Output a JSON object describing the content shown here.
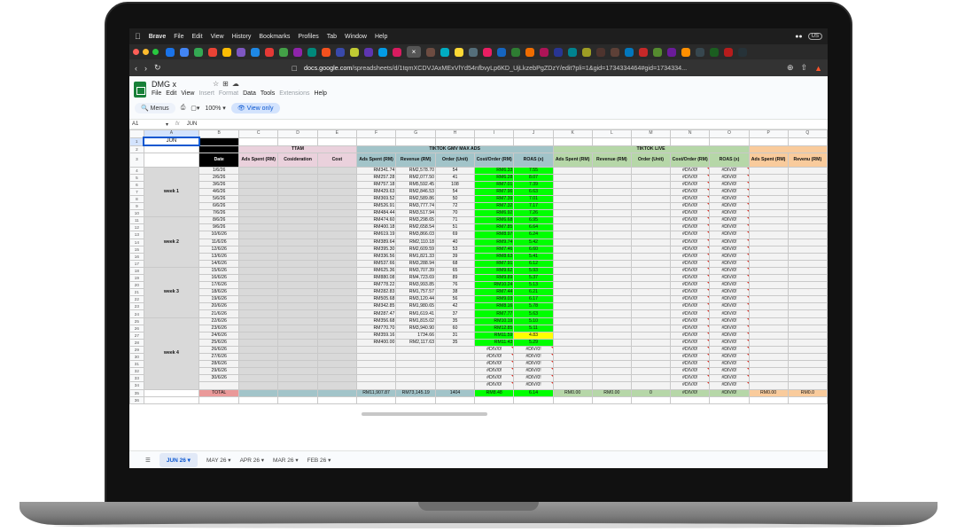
{
  "menubar": {
    "app": "Brave",
    "items": [
      "File",
      "Edit",
      "View",
      "History",
      "Bookmarks",
      "Profiles",
      "Tab",
      "Window",
      "Help"
    ],
    "right_pill": "US"
  },
  "browser": {
    "url_host": "docs.google.com",
    "url_path": "/spreadsheets/d/1tqmXCDVJAxMExVlYd54nfbvyLp6KD_UjLkzebPgZDzY/edit?pli=1&gid=1734334464#gid=1734334..."
  },
  "doc": {
    "title": "DMG x",
    "menu": [
      "File",
      "Edit",
      "View",
      "Insert",
      "Format",
      "Data",
      "Tools",
      "Extensions",
      "Help"
    ],
    "menus_label": "Menus",
    "zoom": "100%",
    "view_only": "View only",
    "cell_ref": "A1",
    "formula": "JUN"
  },
  "columns": [
    "A",
    "B",
    "C",
    "D",
    "E",
    "F",
    "G",
    "H",
    "I",
    "J",
    "K",
    "L",
    "M",
    "N",
    "O",
    "P",
    "Q"
  ],
  "headers": {
    "jun": "JUN",
    "ttam": "TTAM",
    "gmv": "TIKTOK GMV MAX ADS",
    "live": "TIKTOK LIVE",
    "date": "Date",
    "ttam_cols": [
      "Ads Spent (RM)",
      "Cosideration",
      "Cost"
    ],
    "gmv_cols": [
      "Ads Spent (RM)",
      "Revenue (RM)",
      "Order (Unit)",
      "Cost/Order (RM)",
      "ROAS (x)"
    ],
    "live_cols": [
      "Ads Spent (RM)",
      "Revenue (RM)",
      "Order (Unit)",
      "Cost/Order (RM)",
      "ROAS (x)"
    ],
    "next_cols": [
      "Ads Spent (RM)",
      "Revenu (RM)"
    ]
  },
  "weeks": [
    "week 1",
    "week 2",
    "week 3",
    "week 4"
  ],
  "rows": [
    {
      "n": "4",
      "date": "1/6/26",
      "spent": "RM341.74",
      "rev": "RM2,578.70",
      "ord": "54",
      "cpo": "RM6.33",
      "roas": "7.55",
      "live_cpo": "#DIV/0!",
      "live_roas": "#DIV/0!"
    },
    {
      "n": "5",
      "date": "2/6/26",
      "spent": "RM257.28",
      "rev": "RM2,077.50",
      "ord": "41",
      "cpo": "RM6.28",
      "roas": "8.07",
      "live_cpo": "#DIV/0!",
      "live_roas": "#DIV/0!"
    },
    {
      "n": "6",
      "date": "3/6/26",
      "spent": "RM757.18",
      "rev": "RM5,592.45",
      "ord": "108",
      "cpo": "RM7.01",
      "roas": "7.39",
      "live_cpo": "#DIV/0!",
      "live_roas": "#DIV/0!"
    },
    {
      "n": "7",
      "date": "4/6/26",
      "spent": "RM429.63",
      "rev": "RM2,846.53",
      "ord": "54",
      "cpo": "RM7.96",
      "roas": "6.63",
      "live_cpo": "#DIV/0!",
      "live_roas": "#DIV/0!"
    },
    {
      "n": "8",
      "date": "5/6/26",
      "spent": "RM369.52",
      "rev": "RM2,589.86",
      "ord": "50",
      "cpo": "RM7.39",
      "roas": "7.01",
      "live_cpo": "#DIV/0!",
      "live_roas": "#DIV/0!"
    },
    {
      "n": "9",
      "date": "6/6/26",
      "spent": "RM526.91",
      "rev": "RM3,777.74",
      "ord": "72",
      "cpo": "RM7.32",
      "roas": "7.17",
      "live_cpo": "#DIV/0!",
      "live_roas": "#DIV/0!"
    },
    {
      "n": "10",
      "date": "7/6/26",
      "spent": "RM484.44",
      "rev": "RM3,517.94",
      "ord": "70",
      "cpo": "RM6.92",
      "roas": "7.26",
      "live_cpo": "#DIV/0!",
      "live_roas": "#DIV/0!"
    },
    {
      "n": "11",
      "date": "8/6/26",
      "spent": "RM474.60",
      "rev": "RM3,298.65",
      "ord": "71",
      "cpo": "RM6.68",
      "roas": "6.95",
      "live_cpo": "#DIV/0!",
      "live_roas": "#DIV/0!"
    },
    {
      "n": "12",
      "date": "9/6/26",
      "spent": "RM400.18",
      "rev": "RM2,658.54",
      "ord": "51",
      "cpo": "RM7.85",
      "roas": "6.64",
      "live_cpo": "#DIV/0!",
      "live_roas": "#DIV/0!"
    },
    {
      "n": "13",
      "date": "10/6/26",
      "spent": "RM619.19",
      "rev": "RM3,866.03",
      "ord": "69",
      "cpo": "RM8.97",
      "roas": "6.24",
      "live_cpo": "#DIV/0!",
      "live_roas": "#DIV/0!"
    },
    {
      "n": "14",
      "date": "11/6/26",
      "spent": "RM389.64",
      "rev": "RM2,110.18",
      "ord": "40",
      "cpo": "RM9.74",
      "roas": "5.42",
      "live_cpo": "#DIV/0!",
      "live_roas": "#DIV/0!"
    },
    {
      "n": "15",
      "date": "12/6/26",
      "spent": "RM395.30",
      "rev": "RM2,609.59",
      "ord": "53",
      "cpo": "RM7.46",
      "roas": "6.60",
      "live_cpo": "#DIV/0!",
      "live_roas": "#DIV/0!"
    },
    {
      "n": "16",
      "date": "13/6/26",
      "spent": "RM336.56",
      "rev": "RM1,821.33",
      "ord": "39",
      "cpo": "RM8.63",
      "roas": "5.41",
      "live_cpo": "#DIV/0!",
      "live_roas": "#DIV/0!"
    },
    {
      "n": "17",
      "date": "14/6/26",
      "spent": "RM537.66",
      "rev": "RM3,288.94",
      "ord": "68",
      "cpo": "RM7.91",
      "roas": "6.12",
      "live_cpo": "#DIV/0!",
      "live_roas": "#DIV/0!"
    },
    {
      "n": "18",
      "date": "15/6/26",
      "spent": "RM625.36",
      "rev": "RM3,707.39",
      "ord": "65",
      "cpo": "RM9.62",
      "roas": "5.93",
      "live_cpo": "#DIV/0!",
      "live_roas": "#DIV/0!"
    },
    {
      "n": "19",
      "date": "16/6/26",
      "spent": "RM880.08",
      "rev": "RM4,723.69",
      "ord": "89",
      "cpo": "RM9.89",
      "roas": "5.37",
      "live_cpo": "#DIV/0!",
      "live_roas": "#DIV/0!"
    },
    {
      "n": "20",
      "date": "17/6/26",
      "spent": "RM778.22",
      "rev": "RM3,993.85",
      "ord": "76",
      "cpo": "RM10.24",
      "roas": "5.13",
      "live_cpo": "#DIV/0!",
      "live_roas": "#DIV/0!"
    },
    {
      "n": "21",
      "date": "18/6/26",
      "spent": "RM282.83",
      "rev": "RM1,757.57",
      "ord": "38",
      "cpo": "RM7.44",
      "roas": "6.21",
      "live_cpo": "#DIV/0!",
      "live_roas": "#DIV/0!"
    },
    {
      "n": "22",
      "date": "19/6/26",
      "spent": "RM505.68",
      "rev": "RM3,120.44",
      "ord": "56",
      "cpo": "RM9.03",
      "roas": "6.17",
      "live_cpo": "#DIV/0!",
      "live_roas": "#DIV/0!"
    },
    {
      "n": "23",
      "date": "20/6/26",
      "spent": "RM342.85",
      "rev": "RM1,980.65",
      "ord": "42",
      "cpo": "RM8.16",
      "roas": "5.78",
      "live_cpo": "#DIV/0!",
      "live_roas": "#DIV/0!"
    },
    {
      "n": "24",
      "date": "21/6/26",
      "spent": "RM287.47",
      "rev": "RM1,619.41",
      "ord": "37",
      "cpo": "RM7.77",
      "roas": "5.63",
      "live_cpo": "#DIV/0!",
      "live_roas": "#DIV/0!"
    },
    {
      "n": "25",
      "date": "22/6/26",
      "spent": "RM356.68",
      "rev": "RM1,815.02",
      "ord": "35",
      "cpo": "RM10.19",
      "roas": "5.10",
      "live_cpo": "#DIV/0!",
      "live_roas": "#DIV/0!"
    },
    {
      "n": "26",
      "date": "23/6/26",
      "spent": "RM770.70",
      "rev": "RM3,940.90",
      "ord": "60",
      "cpo": "RM12.85",
      "roas": "5.11",
      "live_cpo": "#DIV/0!",
      "live_roas": "#DIV/0!"
    },
    {
      "n": "27",
      "date": "24/6/26",
      "spent": "RM359.16",
      "rev": "1734.66",
      "ord": "31",
      "cpo": "RM11.59",
      "roas": "4.83",
      "live_cpo": "#DIV/0!",
      "live_roas": "#DIV/0!"
    },
    {
      "n": "28",
      "date": "25/6/26",
      "spent": "RM400.00",
      "rev": "RM2,117.63",
      "ord": "35",
      "cpo": "RM11.43",
      "roas": "5.29",
      "live_cpo": "#DIV/0!",
      "live_roas": "#DIV/0!"
    },
    {
      "n": "29",
      "date": "26/6/26",
      "spent": "",
      "rev": "",
      "ord": "",
      "cpo": "#DIV/0!",
      "roas": "#DIV/0!",
      "live_cpo": "#DIV/0!",
      "live_roas": "#DIV/0!"
    },
    {
      "n": "30",
      "date": "27/6/26",
      "spent": "",
      "rev": "",
      "ord": "",
      "cpo": "#DIV/0!",
      "roas": "#DIV/0!",
      "live_cpo": "#DIV/0!",
      "live_roas": "#DIV/0!"
    },
    {
      "n": "31",
      "date": "28/6/26",
      "spent": "",
      "rev": "",
      "ord": "",
      "cpo": "#DIV/0!",
      "roas": "#DIV/0!",
      "live_cpo": "#DIV/0!",
      "live_roas": "#DIV/0!"
    },
    {
      "n": "32",
      "date": "29/6/26",
      "spent": "",
      "rev": "",
      "ord": "",
      "cpo": "#DIV/0!",
      "roas": "#DIV/0!",
      "live_cpo": "#DIV/0!",
      "live_roas": "#DIV/0!"
    },
    {
      "n": "33",
      "date": "30/6/26",
      "spent": "",
      "rev": "",
      "ord": "",
      "cpo": "#DIV/0!",
      "roas": "#DIV/0!",
      "live_cpo": "#DIV/0!",
      "live_roas": "#DIV/0!"
    },
    {
      "n": "34",
      "date": "",
      "spent": "",
      "rev": "",
      "ord": "",
      "cpo": "#DIV/0!",
      "roas": "#DIV/0!",
      "live_cpo": "#DIV/0!",
      "live_roas": "#DIV/0!"
    }
  ],
  "total": {
    "label": "TOTAL",
    "spent": "RM11,907.87",
    "rev": "RM73,145.19",
    "ord": "1404",
    "cpo": "RM8.48",
    "roas": "6.14",
    "live_spent": "RM0.00",
    "live_rev": "RM0.00",
    "live_ord": "0",
    "live_cpo": "#DIV/0!",
    "live_roas": "#DIV/0!",
    "next_spent": "RM0.00",
    "next_rev": "RM0.0"
  },
  "sheet_tabs": [
    "JUN 26",
    "MAY 26",
    "APR 26",
    "MAR 26",
    "FEB 26"
  ],
  "colors": {
    "highlight_green": "#00ff00",
    "highlight_yellow": "#ffff00",
    "total_pink": "#ea9999",
    "accent_blue": "#0b57d0"
  }
}
